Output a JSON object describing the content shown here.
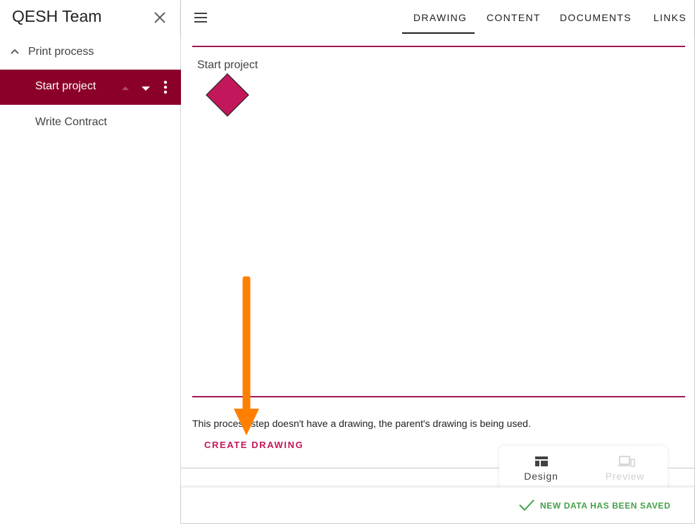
{
  "sidebar": {
    "title": "QESH Team",
    "parent_item": "Print process",
    "active_item": "Start project",
    "child_item": "Write Contract"
  },
  "tabs": [
    {
      "label": "DRAWING",
      "active": true
    },
    {
      "label": "CONTENT",
      "active": false
    },
    {
      "label": "DOCUMENTS",
      "active": false
    },
    {
      "label": "LINKS",
      "active": false
    }
  ],
  "drawing": {
    "node_label": "Start project",
    "info_text": "This process step doesn't have a drawing, the parent's drawing is being used.",
    "create_button": "CREATE DRAWING"
  },
  "view_toggle": {
    "design_label": "Design",
    "preview_label": "Preview",
    "active": "Design"
  },
  "status": {
    "message": "NEW DATA HAS BEEN SAVED"
  },
  "colors": {
    "brand": "#8b0029",
    "accent": "#c2185b",
    "node_fill": "#c2185b",
    "divider": "#a0175a",
    "success": "#43a047",
    "annotation_arrow": "#ff7f00"
  },
  "icons": {
    "close": "close-icon",
    "collapse": "chevron-up-icon",
    "move_up": "arrow-up-icon",
    "move_down": "arrow-down-icon",
    "more": "more-vert-icon",
    "menu": "hamburger-menu-icon",
    "design": "dashboard-icon",
    "preview": "devices-icon",
    "saved": "checkmark-icon"
  }
}
